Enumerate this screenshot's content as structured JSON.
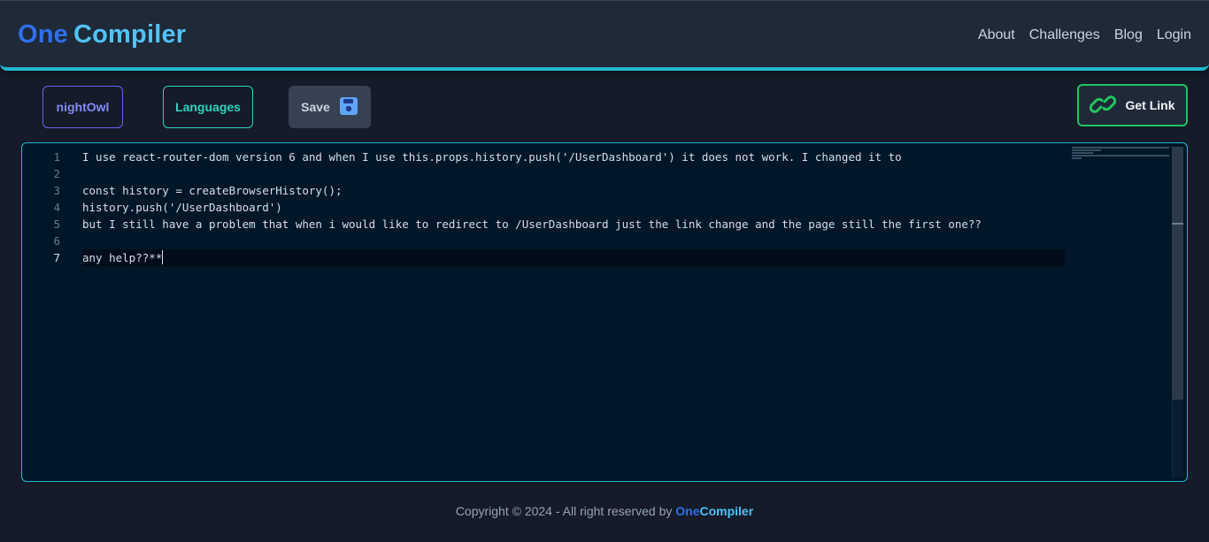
{
  "header": {
    "logo_one": "One",
    "logo_compiler": "Compiler",
    "nav": [
      "About",
      "Challenges",
      "Blog",
      "Login"
    ]
  },
  "toolbar": {
    "theme_label": "nightOwl",
    "languages_label": "Languages",
    "save_label": "Save",
    "get_link_label": "Get Link"
  },
  "editor": {
    "line_numbers": [
      "1",
      "2",
      "3",
      "4",
      "5",
      "6",
      "7"
    ],
    "lines": [
      "I use react-router-dom version 6 and when I use this.props.history.push('/UserDashboard') it does not work. I changed it to",
      "",
      "const history = createBrowserHistory();",
      "history.push('/UserDashboard')",
      "but I still have a problem that when i would like to redirect to /UserDashboard just the link change and the page still the first one??",
      "",
      "any help??**"
    ],
    "active_line": 7
  },
  "footer": {
    "copyright": "Copyright © 2024 - All right reserved by ",
    "brand_one": "One",
    "brand_compiler": "Compiler"
  },
  "colors": {
    "accent": "#22b8cf",
    "brand_blue": "#2f6fed",
    "brand_cyan": "#4fc3f7",
    "get_link_border": "#22c55e"
  },
  "icons": {
    "save": "floppy-disk-icon",
    "get_link": "chain-link-icon"
  }
}
